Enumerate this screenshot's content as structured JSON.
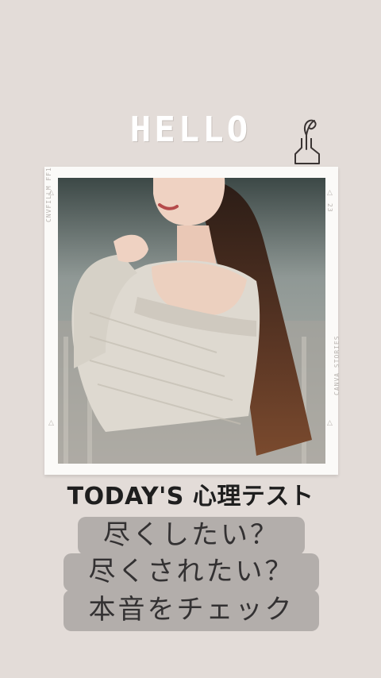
{
  "greeting": "HELLO",
  "film_labels": {
    "left": "CNVFILLM FF1",
    "right_top": "23",
    "right_bottom": "CANVA STORIES"
  },
  "subtitle": "TODAY'S  心理テスト",
  "tags": [
    "尽くしたい？",
    "尽くされたい？",
    "本音をチェック"
  ],
  "colors": {
    "background": "#e3dcd8",
    "frame": "#fbfaf8",
    "tag_background": "#b3aeab"
  }
}
